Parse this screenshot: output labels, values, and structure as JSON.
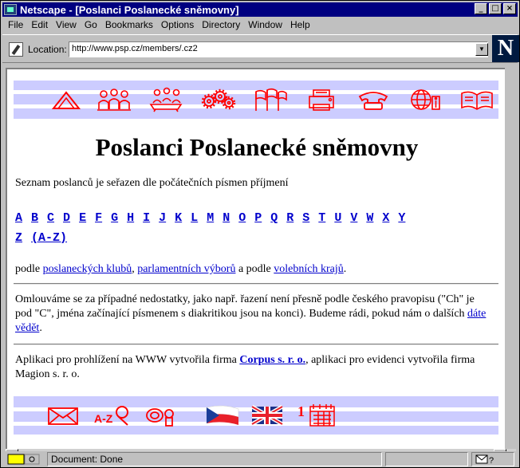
{
  "window": {
    "title": "Netscape - [Poslanci Poslanecké sněmovny]"
  },
  "menu": [
    "File",
    "Edit",
    "View",
    "Go",
    "Bookmarks",
    "Options",
    "Directory",
    "Window",
    "Help"
  ],
  "location": {
    "label": "Location:",
    "url": "http://www.psp.cz/members/.cz2"
  },
  "page": {
    "title": "Poslanci Poslanecké sněmovny",
    "intro": "Seznam poslanců je seřazen dle počátečních písmen příjmení",
    "letters": [
      "A",
      "B",
      "C",
      "D",
      "E",
      "F",
      "G",
      "H",
      "I",
      "J",
      "K",
      "L",
      "M",
      "N",
      "O",
      "P",
      "Q",
      "R",
      "S",
      "T",
      "U",
      "V",
      "W",
      "X",
      "Y",
      "Z",
      "(A-Z)"
    ],
    "podle": {
      "prefix": "podle ",
      "link1": "poslaneckých klubů",
      "sep": ", ",
      "link2": "parlamentních výborů",
      "mid": " a podle ",
      "link3": "volebních krajů",
      "end": "."
    },
    "apology": {
      "text": "Omlouváme se za případné nedostatky, jako např. řazení není přesně podle českého pravopisu (\"Ch\" je pod \"C\", jména začínající písmenem s diakritikou jsou na konci). Budeme rádi, pokud nám o dalších ",
      "link": "dáte vědět",
      "end": "."
    },
    "credits": {
      "prefix": "Aplikaci pro prohlížení na WWW vytvořila firma ",
      "link": "Corpus s. r. o.",
      "suffix": ", aplikaci pro evidenci vytvořila firma Magion s. r. o."
    }
  },
  "status": {
    "text": "Document: Done"
  },
  "colors": {
    "titlebar": "#000080",
    "link": "#0000cc",
    "band": "#ccccff",
    "icon": "#ff0000"
  },
  "icons": {
    "top": [
      "home-triangle-icon",
      "people-group-icon",
      "meeting-table-icon",
      "gears-icon",
      "flags-icon",
      "printer-icon",
      "telephone-icon",
      "globe-info-icon",
      "open-book-icon"
    ],
    "bottom": [
      "envelope-icon",
      "a-z-magnifier-icon",
      "stamp-icon",
      "czech-flag-icon",
      "uk-flag-icon",
      "calendar-icon"
    ]
  }
}
